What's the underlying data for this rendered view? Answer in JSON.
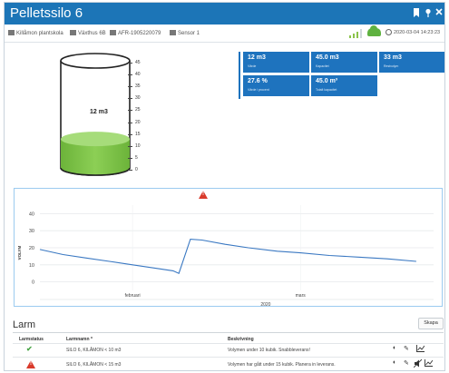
{
  "window": {
    "title": "Pelletssilo 6"
  },
  "titlebar_icons": [
    "bookmark-icon",
    "pin-icon",
    "close-icon"
  ],
  "infobar": {
    "crumbs": [
      {
        "icon": "sitemap-icon",
        "label": "Killåmon plantskola"
      },
      {
        "icon": "user-icon",
        "label": "Växthus 6B"
      },
      {
        "icon": "barcode-icon",
        "label": "AFR-1905220079"
      },
      {
        "icon": "flag-icon",
        "label": "Sensor 1"
      }
    ],
    "timestamp": "2020-03-04 14:23:23",
    "status": {
      "signal_icon": "signal-bars-icon",
      "cloud_icon": "cloud-icon",
      "clock_icon": "clock-icon"
    }
  },
  "silo": {
    "current_value": "12 m3",
    "scale": [
      "45",
      "40",
      "35",
      "30",
      "25",
      "20",
      "15",
      "10",
      "5",
      "0"
    ],
    "fill_fraction": 0.27,
    "fill_color": "#7dc242"
  },
  "tiles": [
    {
      "value": "12 m3",
      "label": "Värde"
    },
    {
      "value": "45.0 m3",
      "label": "Kapacitet"
    },
    {
      "value": "33 m3",
      "label": "Restvolym"
    },
    {
      "value": "27.6 %",
      "label": "Värde i procent"
    },
    {
      "value": "45.0 m³",
      "label": "Totalt kapacitet"
    }
  ],
  "chart_data": {
    "type": "line",
    "ylabel": "VOLYM",
    "ylim": [
      -5,
      45
    ],
    "yticks": [
      "40",
      "30",
      "20",
      "10",
      "0"
    ],
    "x_tick_labels": [
      "februari",
      "mars"
    ],
    "x_sub_label": "2020",
    "series": [
      {
        "color": "#3a78c2",
        "x": [
          "2020-01-20",
          "2020-01-24",
          "2020-01-28",
          "2020-02-01",
          "2020-02-05",
          "2020-02-09",
          "2020-02-12",
          "2020-02-13",
          "2020-02-15",
          "2020-02-17",
          "2020-02-21",
          "2020-02-25",
          "2020-03-01",
          "2020-03-05",
          "2020-03-10",
          "2020-03-15",
          "2020-03-20",
          "2020-03-25"
        ],
        "y": [
          19,
          16,
          14,
          12,
          10,
          8,
          6.5,
          5,
          25,
          24.5,
          22,
          20,
          18,
          17,
          15.5,
          14.5,
          13.5,
          12
        ]
      }
    ],
    "x_range": [
      "2020-01-20",
      "2020-03-28"
    ],
    "tick_dates": [
      "2020-02-05",
      "2020-03-05"
    ],
    "sub_date": "2020-02-28"
  },
  "alarm": {
    "title": "Larm",
    "create_label": "Skapa",
    "headers": {
      "status": "Larmstatus",
      "name": "Larmnamn *",
      "description": "Beskrivning"
    },
    "rows": [
      {
        "status": "ok",
        "status_icon": "check-icon",
        "name": "SILO 6, KILÅMON < 10 m3",
        "description": "Volymen under 10 kubik. Snabbleverans!",
        "actions": [
          "toggle-icon",
          "edit-icon",
          "chart-icon"
        ]
      },
      {
        "status": "alarm",
        "status_icon": "warning-icon",
        "name": "SILO 6, KILÅMON < 15 m3",
        "description": "Volymen har gått under 15 kubik. Planera in leverans.",
        "actions": [
          "toggle-icon",
          "edit-icon",
          "mute-icon",
          "chart-icon"
        ]
      }
    ]
  },
  "colors": {
    "brand": "#1c75b7",
    "tile": "#1e73be",
    "alert": "#d93a2b",
    "ok": "#49a547",
    "fill": "#7dc242"
  }
}
